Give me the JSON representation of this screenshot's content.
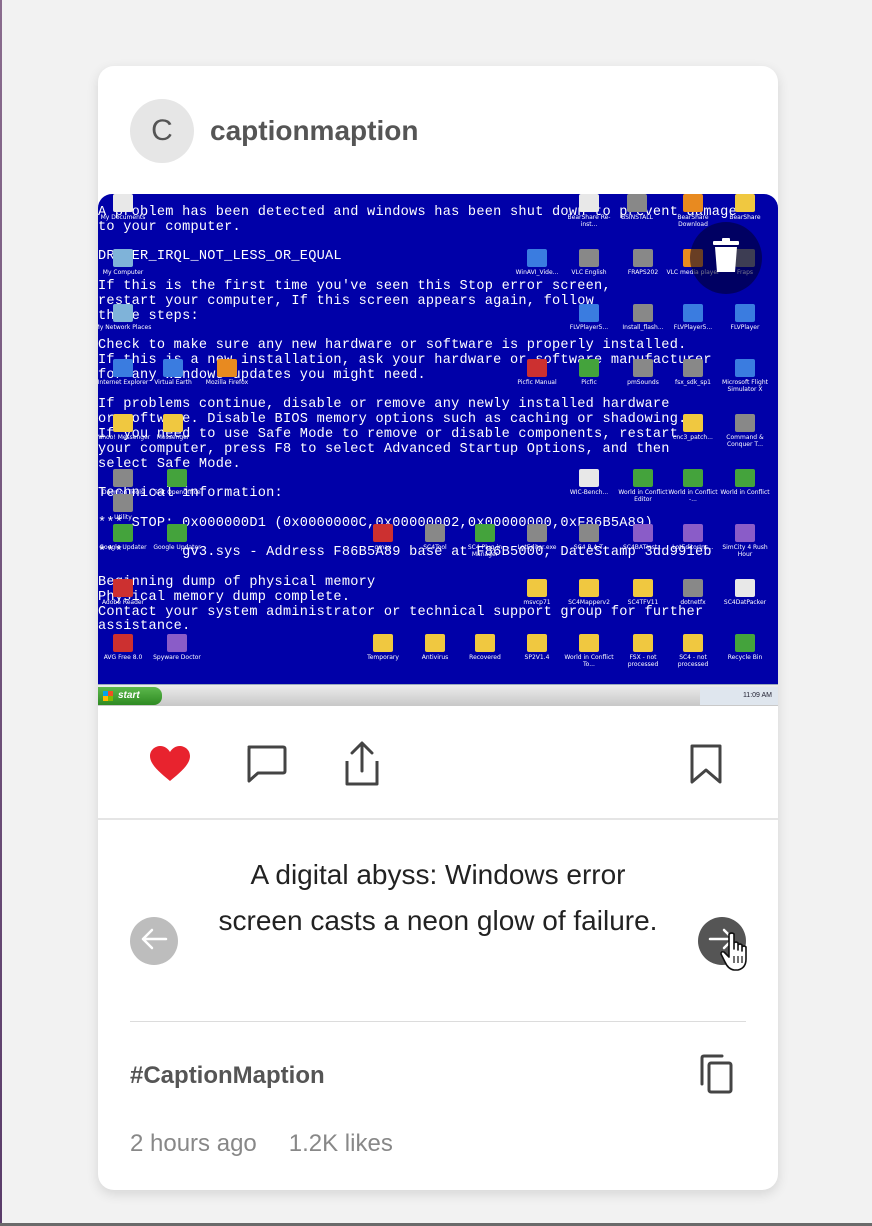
{
  "post": {
    "avatar_initial": "C",
    "username": "captionmaption",
    "caption": "A digital abyss: Windows error screen casts a neon glow of failure.",
    "hashtag": "#CaptionMaption",
    "time_ago": "2 hours ago",
    "likes": "1.2K likes",
    "liked": true
  },
  "colors": {
    "like": "#e8232e",
    "bsod_blue": "#0000a8"
  },
  "icons": {
    "delete": "trash-icon",
    "like": "heart-icon",
    "comment": "comment-icon",
    "share": "share-icon",
    "save": "bookmark-icon",
    "prev": "arrow-left-icon",
    "next": "arrow-right-icon",
    "copy": "copy-icon"
  },
  "screenshot": {
    "bsod_lines": [
      "A problem has been detected and windows has been shut down to prevent damage",
      "to your computer.",
      "",
      "DRIVER_IRQL_NOT_LESS_OR_EQUAL",
      "",
      "If this is the first time you've seen this Stop error screen,",
      "restart your computer, If this screen appears again, follow",
      "these steps:",
      "",
      "Check to make sure any new hardware or software is properly installed.",
      "If this is a new installation, ask your hardware or software manufacturer",
      "for any Windows updates you might need.",
      "",
      "If problems continue, disable or remove any newly installed hardware",
      "or software. Disable BIOS memory options such as caching or shadowing.",
      "If you need to use Safe Mode to remove or disable components, restart",
      "your computer, press F8 to select Advanced Startup Options, and then",
      "select Safe Mode.",
      "",
      "Technical information:",
      "",
      "*** STOP: 0x000000D1 (0x0000000C,0x00000002,0x00000000,0xF86B5A89)",
      "",
      "***       gv3.sys - Address F86B5A89 base at F86B5000, DateStamp 3dd991eb",
      "",
      "Beginning dump of physical memory",
      "Physical memory dump complete.",
      "Contact your system administrator or technical support group for further",
      "assistance."
    ],
    "desktop_icons": [
      {
        "label": "My Documents",
        "kind": "doc"
      },
      {
        "label": "My Computer",
        "kind": "pc"
      },
      {
        "label": "My Network Places",
        "kind": "pc"
      },
      {
        "label": "Internet Explorer",
        "kind": "blu"
      },
      {
        "label": "Virtual Earth",
        "kind": "blu"
      },
      {
        "label": "Mozilla Firefox",
        "kind": "org"
      },
      {
        "label": "Yahoo! Messenger",
        "kind": "yel"
      },
      {
        "label": "Messenger",
        "kind": "yel"
      },
      {
        "label": "Daemon Tools",
        "kind": "gry"
      },
      {
        "label": "Utility",
        "kind": "gry"
      },
      {
        "label": "Test OpenOffice",
        "kind": "grn"
      },
      {
        "label": "Google Updater",
        "kind": "grn"
      },
      {
        "label": "Google Updater",
        "kind": "grn"
      },
      {
        "label": "Adobe Reader",
        "kind": "red"
      },
      {
        "label": "AVG Free 8.0",
        "kind": "red"
      },
      {
        "label": "Spyware Doctor",
        "kind": "pur"
      },
      {
        "label": "BearShare Re-inst...",
        "kind": "doc"
      },
      {
        "label": "BSINSTALL",
        "kind": "gry"
      },
      {
        "label": "BearShare Download",
        "kind": "org"
      },
      {
        "label": "BearShare",
        "kind": "yel"
      },
      {
        "label": "WinAVI_Vide...",
        "kind": "blu"
      },
      {
        "label": "VLC English",
        "kind": "gry"
      },
      {
        "label": "FRAPS202",
        "kind": "gry"
      },
      {
        "label": "VLC media player",
        "kind": "org"
      },
      {
        "label": "Fraps",
        "kind": "gry"
      },
      {
        "label": "FLVPlayer5...",
        "kind": "blu"
      },
      {
        "label": "Install_flash...",
        "kind": "gry"
      },
      {
        "label": "FLVPlayer5...",
        "kind": "blu"
      },
      {
        "label": "FLVPlayer",
        "kind": "blu"
      },
      {
        "label": "Picfic Manual",
        "kind": "red"
      },
      {
        "label": "Picfic",
        "kind": "grn"
      },
      {
        "label": "pmSounds",
        "kind": "gry"
      },
      {
        "label": "fsx_sdk_sp1",
        "kind": "gry"
      },
      {
        "label": "Microsoft Flight Simulator X",
        "kind": "blu"
      },
      {
        "label": "cnc3_patch...",
        "kind": "yel"
      },
      {
        "label": "Command & Conquer T...",
        "kind": "gry"
      },
      {
        "label": "WIC-Bench...",
        "kind": "doc"
      },
      {
        "label": "World in Conflict Editor",
        "kind": "grn"
      },
      {
        "label": "World in Conflict -...",
        "kind": "grn"
      },
      {
        "label": "World in Conflict",
        "kind": "grn"
      },
      {
        "label": "gmax",
        "kind": "red"
      },
      {
        "label": "SC4Tool",
        "kind": "gry"
      },
      {
        "label": "SC4 Plug-in Manager",
        "kind": "grn"
      },
      {
        "label": "LotEditor.exe",
        "kind": "gry"
      },
      {
        "label": "SC4 B.A.T.",
        "kind": "gry"
      },
      {
        "label": "SC4BATInst...",
        "kind": "pur"
      },
      {
        "label": "LotEditorIns...",
        "kind": "pur"
      },
      {
        "label": "SimCity 4 Rush Hour",
        "kind": "pur"
      },
      {
        "label": "msvcp71",
        "kind": "yel"
      },
      {
        "label": "SC4Mapperv2",
        "kind": "yel"
      },
      {
        "label": "SC4TFV11",
        "kind": "yel"
      },
      {
        "label": "dotnetfx",
        "kind": "gry"
      },
      {
        "label": "SC4DatPacker",
        "kind": "doc"
      },
      {
        "label": "Temporary",
        "kind": "yel"
      },
      {
        "label": "Antivirus",
        "kind": "yel"
      },
      {
        "label": "Recovered",
        "kind": "yel"
      },
      {
        "label": "SP2V1.4",
        "kind": "yel"
      },
      {
        "label": "World in Conflict To...",
        "kind": "yel"
      },
      {
        "label": "FSX - not processed",
        "kind": "yel"
      },
      {
        "label": "SC4 - not processed",
        "kind": "yel"
      },
      {
        "label": "Recycle Bin",
        "kind": "grn"
      }
    ],
    "taskbar": {
      "start": "start",
      "clock": "11:09 AM"
    }
  }
}
